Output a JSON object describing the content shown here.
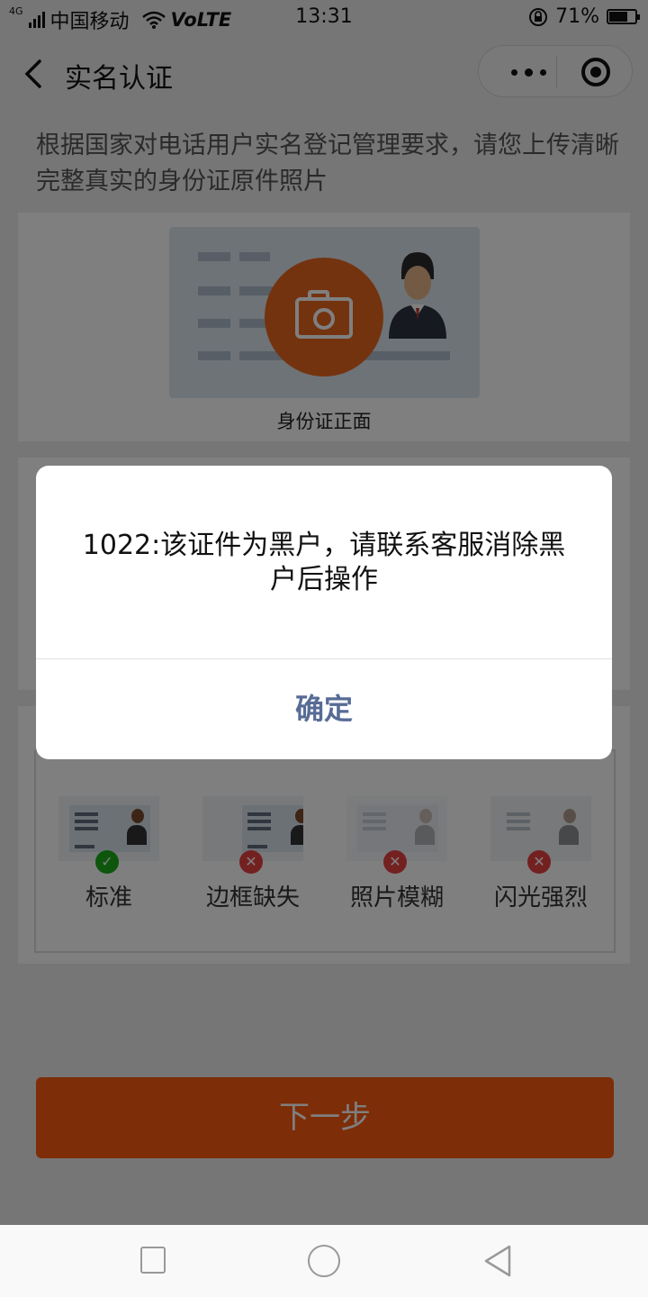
{
  "status_bar": {
    "network": "4G",
    "carrier": "中国移动",
    "volte": "VoLTE",
    "time": "13:31",
    "battery": "71%",
    "battery_level": 0.71
  },
  "nav": {
    "title": "实名认证"
  },
  "intro_text": "根据国家对电话用户实名登记管理要求，请您上传清晰完整真实的身份证原件照片",
  "id_front_label": "身份证正面",
  "examples": [
    {
      "label": "标准",
      "status": "ok"
    },
    {
      "label": "边框缺失",
      "status": "error"
    },
    {
      "label": "照片模糊",
      "status": "error"
    },
    {
      "label": "闪光强烈",
      "status": "error"
    }
  ],
  "next_button": "下一步",
  "dialog": {
    "message": "1022:该证件为黑户，请联系客服消除黑户后操作",
    "confirm": "确定"
  },
  "colors": {
    "accent": "#fa5b0f",
    "dialog_button": "#576b95",
    "ok": "#1aad19",
    "error": "#e64340"
  }
}
